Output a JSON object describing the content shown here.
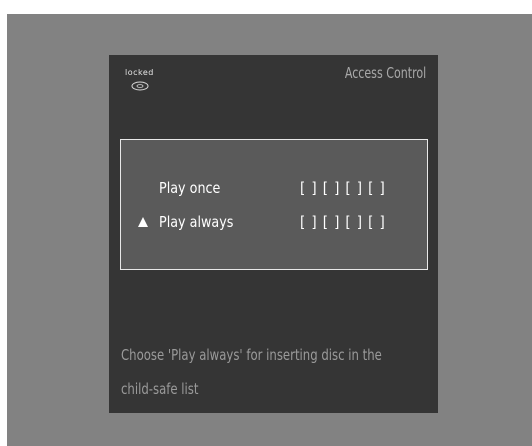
{
  "header": {
    "locked_label": "locked",
    "title": "Access Control",
    "lock_icon": "lock-disc-icon"
  },
  "options": [
    {
      "label": "Play once",
      "code_slots": "[ ] [ ] [ ] [ ]",
      "selected": false
    },
    {
      "label": "Play always",
      "code_slots": "[ ] [ ] [ ] [ ]",
      "selected": true
    }
  ],
  "hint": {
    "line1": "Choose 'Play always' for inserting disc in the",
    "line2": "child-safe list"
  },
  "colors": {
    "outer_background": "#828282",
    "screen_background": "#353535",
    "panel_background": "#5a5a5a",
    "panel_border": "#e8e8e8",
    "title_text": "#a8a8a8",
    "hint_text": "#9a9a9a",
    "option_text": "#ffffff"
  }
}
